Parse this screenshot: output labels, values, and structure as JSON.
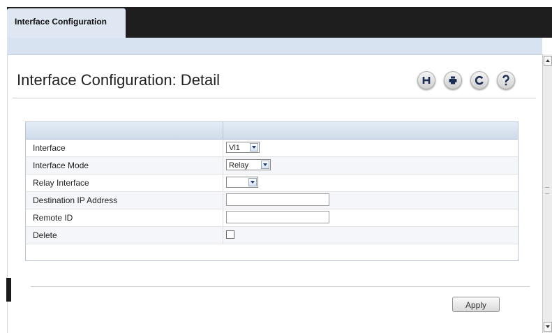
{
  "tabs": [
    {
      "label": "Interface Configuration",
      "active": true
    }
  ],
  "page": {
    "title": "Interface Configuration: Detail"
  },
  "toolbar": {
    "icons": [
      {
        "name": "save-icon",
        "glyph": "H"
      },
      {
        "name": "print-icon",
        "glyph": "print"
      },
      {
        "name": "refresh-icon",
        "glyph": "C"
      },
      {
        "name": "help-icon",
        "glyph": "?"
      }
    ]
  },
  "form": {
    "rows": [
      {
        "label": "Interface",
        "control": "select",
        "value": "Vl1"
      },
      {
        "label": "Interface Mode",
        "control": "select",
        "value": "Relay"
      },
      {
        "label": "Relay Interface",
        "control": "select",
        "value": ""
      },
      {
        "label": "Destination IP Address",
        "control": "text",
        "value": ""
      },
      {
        "label": "Remote ID",
        "control": "text",
        "value": ""
      },
      {
        "label": "Delete",
        "control": "checkbox",
        "checked": false
      }
    ]
  },
  "actions": {
    "apply_label": "Apply"
  },
  "colors": {
    "topbar": "#1e1e1e",
    "tab_active": "#dfe7f2",
    "header_gradient_top": "#e4ecf6",
    "header_gradient_bottom": "#cfdbea",
    "select_arrow": "#1d3b73"
  }
}
